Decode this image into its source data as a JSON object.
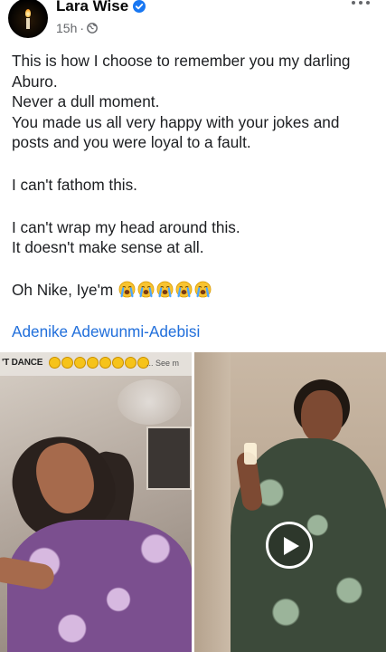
{
  "header": {
    "author": "Lara Wise",
    "time": "15h",
    "separator": "·",
    "icons": {
      "verified": "verified-badge-icon",
      "privacy": "globe-icon",
      "more": "more-options-icon"
    }
  },
  "post": {
    "lines": [
      "This is how I choose to remember you my darling Aburo.",
      "Never a dull moment.",
      "You made us all very happy with your jokes and posts and you were loyal to a fault.",
      "I can't fathom this.",
      "I can't wrap my head around this.",
      "It doesn't make sense at all.",
      "Oh Nike, Iye'm"
    ],
    "emoji_name": "loudly-crying-face-icon",
    "emoji_count": 5,
    "tagged_user": "Adenike Adewunmi-Adebisi"
  },
  "media": {
    "left_banner_text": "'T DANCE",
    "left_banner_more": "... See m",
    "play_icon": "play-icon"
  },
  "colors": {
    "link": "#216fdb",
    "verified": "#1877f2",
    "meta": "#65676b"
  }
}
